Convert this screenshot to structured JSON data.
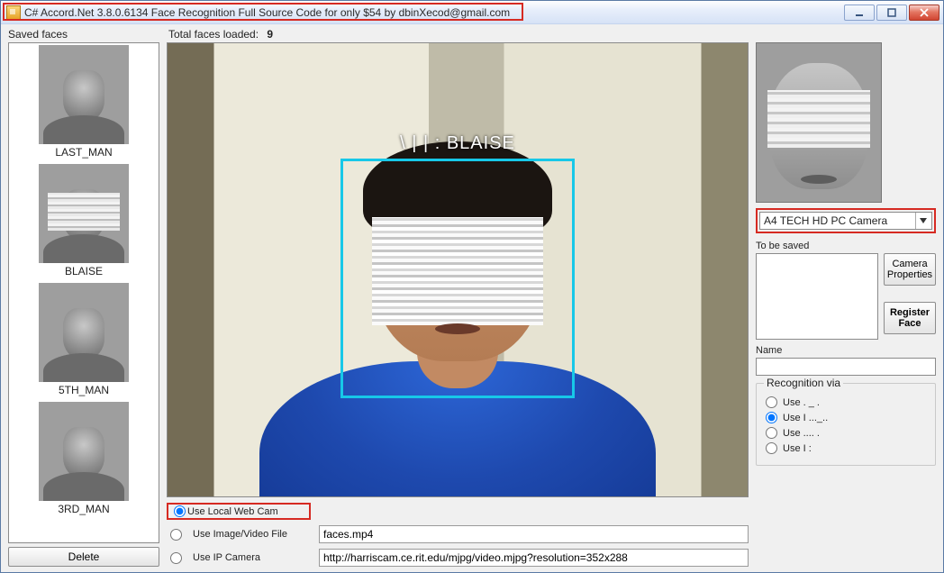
{
  "window_title": "C# Accord.Net 3.8.0.6134 Face Recognition Full Source Code for only $54 by dbinXecod@gmail.com",
  "header": {
    "saved_faces_label": "Saved faces",
    "total_label": "Total faces loaded:",
    "total_value": "9"
  },
  "saved_faces": [
    {
      "label": "LAST_MAN",
      "censored": false
    },
    {
      "label": "BLAISE",
      "censored": true
    },
    {
      "label": "5TH_MAN",
      "censored": false
    },
    {
      "label": "3RD_MAN",
      "censored": false
    }
  ],
  "delete_label": "Delete",
  "detection": {
    "name_overlay": "\\ | | : BLAISE"
  },
  "source": {
    "webcam": {
      "label": "Use Local Web Cam",
      "checked": true
    },
    "file": {
      "label": "Use Image/Video File",
      "value": "faces.mp4",
      "checked": false
    },
    "ip": {
      "label": "Use IP Camera",
      "value": "http://harriscam.ce.rit.edu/mjpg/video.mjpg?resolution=352x288",
      "checked": false
    }
  },
  "right": {
    "camera_selected": "A4 TECH HD PC Camera",
    "to_save_label": "To be saved",
    "camera_props_label": "Camera Properties",
    "register_label": "Register Face",
    "name_label": "Name",
    "recognition_legend": "Recognition via",
    "recognition_options": [
      {
        "label": "Use . _   .",
        "checked": false
      },
      {
        "label": "Use I ..._..",
        "checked": true
      },
      {
        "label": "Use .... .",
        "checked": false
      },
      {
        "label": "Use I   :",
        "checked": false
      }
    ]
  }
}
